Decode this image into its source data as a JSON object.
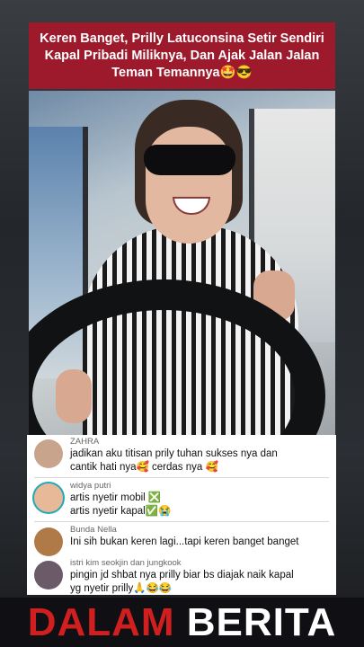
{
  "title": {
    "text": "Keren Banget, Prilly Latuconsina Setir Sendiri Kapal Pribadi Miliknya, Dan Ajak Jalan Jalan Teman Temannya🤩😎",
    "background": "#9c1a2c"
  },
  "comments": [
    {
      "user": "ZAHRA",
      "lines": [
        "jadikan aku titisan prily tuhan sukses nya dan",
        "cantik hati nya🥰 cerdas nya 🥰"
      ],
      "avatar_color": "#c9a48c"
    },
    {
      "user": "widya putri",
      "lines": [
        "artis nyetir mobil ❎",
        "artis nyetir kapal✅😭"
      ],
      "avatar_color": "#e7b999"
    },
    {
      "user": "Bunda Nella",
      "lines": [
        "Ini sih bukan keren lagi...tapi keren banget banget"
      ],
      "avatar_color": "#b07a48"
    },
    {
      "user": "istri kim seokjin dan jungkook",
      "lines": [
        "pingin jd shbat nya prilly biar bs diajak naik kapal",
        "yg nyetir prilly🙏😂😂"
      ],
      "avatar_color": "#6b5a68"
    }
  ],
  "brand": {
    "part1": "DALAM",
    "part2": "BERITA",
    "color1": "#d11f1f",
    "color2": "#ffffff"
  }
}
